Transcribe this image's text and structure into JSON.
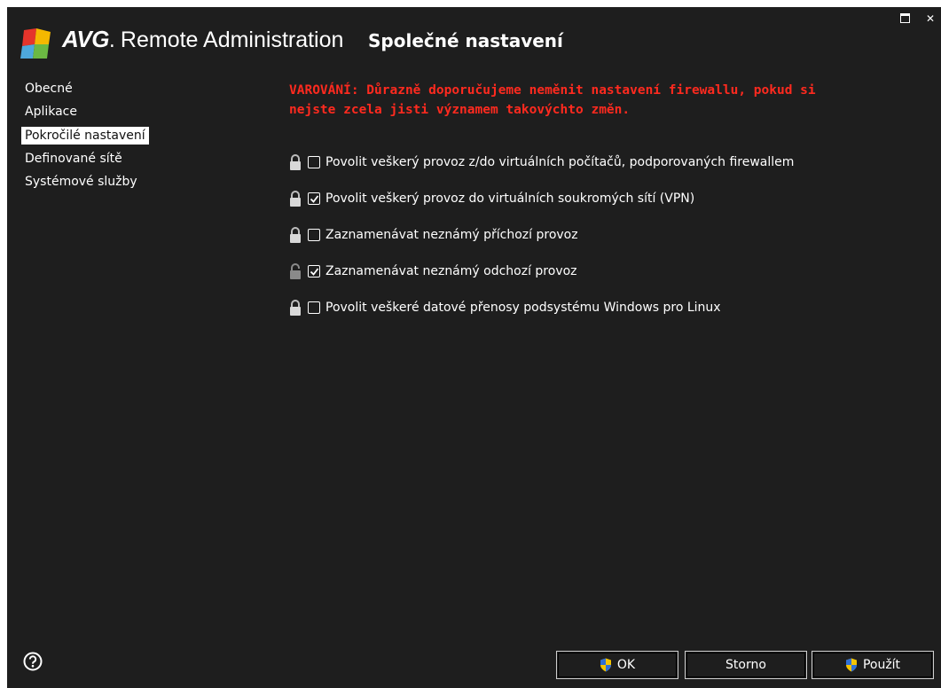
{
  "window": {
    "brand_avg": "AVG",
    "brand_dot": ".",
    "brand_rest": "Remote Administration",
    "title": "Společné nastavení",
    "icons": {
      "logo": "avg-logo",
      "maximize": "maximize-icon",
      "close": "close-icon"
    }
  },
  "sidebar": {
    "items": [
      {
        "label": "Obecné",
        "active": false
      },
      {
        "label": "Aplikace",
        "active": false
      },
      {
        "label": "Pokročilé nastavení",
        "active": true
      },
      {
        "label": "Definované sítě",
        "active": false
      },
      {
        "label": "Systémové služby",
        "active": false
      }
    ]
  },
  "warning": {
    "line1": "VAROVÁNÍ: Důrazně doporučujeme neměnit nastavení firewallu, pokud si",
    "line2": "nejste zcela jisti významem takovýchto změn.",
    "color": "#ff2a1f"
  },
  "options": [
    {
      "label": "Povolit veškerý provoz z/do virtuálních počítačů, podporovaných firewallem",
      "checked": false,
      "lock": "locked"
    },
    {
      "label": "Povolit veškerý provoz do virtuálních soukromých sítí (VPN)",
      "checked": true,
      "lock": "locked"
    },
    {
      "label": "Zaznamenávat neznámý příchozí provoz",
      "checked": false,
      "lock": "locked"
    },
    {
      "label": "Zaznamenávat neznámý odchozí provoz",
      "checked": true,
      "lock": "unlocked"
    },
    {
      "label": "Povolit veškeré datové přenosy podsystému Windows pro Linux",
      "checked": false,
      "lock": "locked"
    }
  ],
  "footer": {
    "help_icon": "help-icon",
    "ok_label": "OK",
    "cancel_label": "Storno",
    "apply_label": "Použít",
    "shield_icon": "uac-shield-icon"
  },
  "colors": {
    "background": "#1e1e1e",
    "text": "#ffffff",
    "warning": "#ff2a1f"
  }
}
